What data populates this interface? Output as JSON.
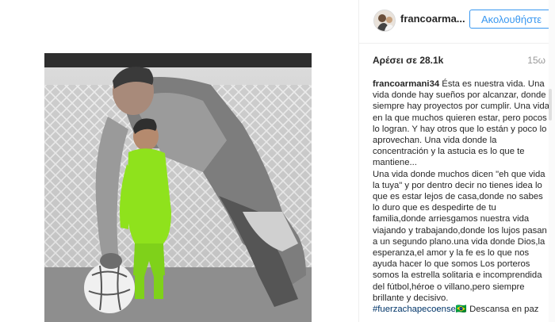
{
  "post": {
    "username": "francoarma...",
    "follow_label": "Ακολουθήστε",
    "likes_label": "Αρέσει σε 28.1k",
    "time_ago": "15ω",
    "caption_user": "francoarmani34",
    "caption_first": " Ésta es nuestra vida. Una vida donde hay sueños por alcanzar, donde siempre hay proyectos por cumplir. Una vida en la que muchos quieren estar, pero pocos lo logran. Y hay otros que lo están y poco lo aprovechan. Una vida donde la concentración y la astucia es lo que te mantiene...",
    "caption_second": "Una vida donde muchos dicen \"eh que vida la tuya\" y por dentro decir no tienes idea lo que es estar lejos de casa,donde no sabes lo duro que es despedirte de tu familia,donde arriesgamos nuestra vida viajando y trabajando,donde los lujos pasan a un segundo plano.una vida donde Dios,la esperanza,el amor y la fe es lo que nos ayuda hacer lo que somos Los porteros somos la estrella solitaria e incomprendida del fútbol,héroe o villano,pero siempre brillante y decisivo.",
    "hashtag": "#fuerzachapecoense",
    "hashtag_flag": "🇧🇷",
    "caption_end": " Descansa en paz"
  },
  "colors": {
    "follow_blue": "#3897f0",
    "hashtag": "#003569",
    "jersey_green": "#8fe21c"
  }
}
